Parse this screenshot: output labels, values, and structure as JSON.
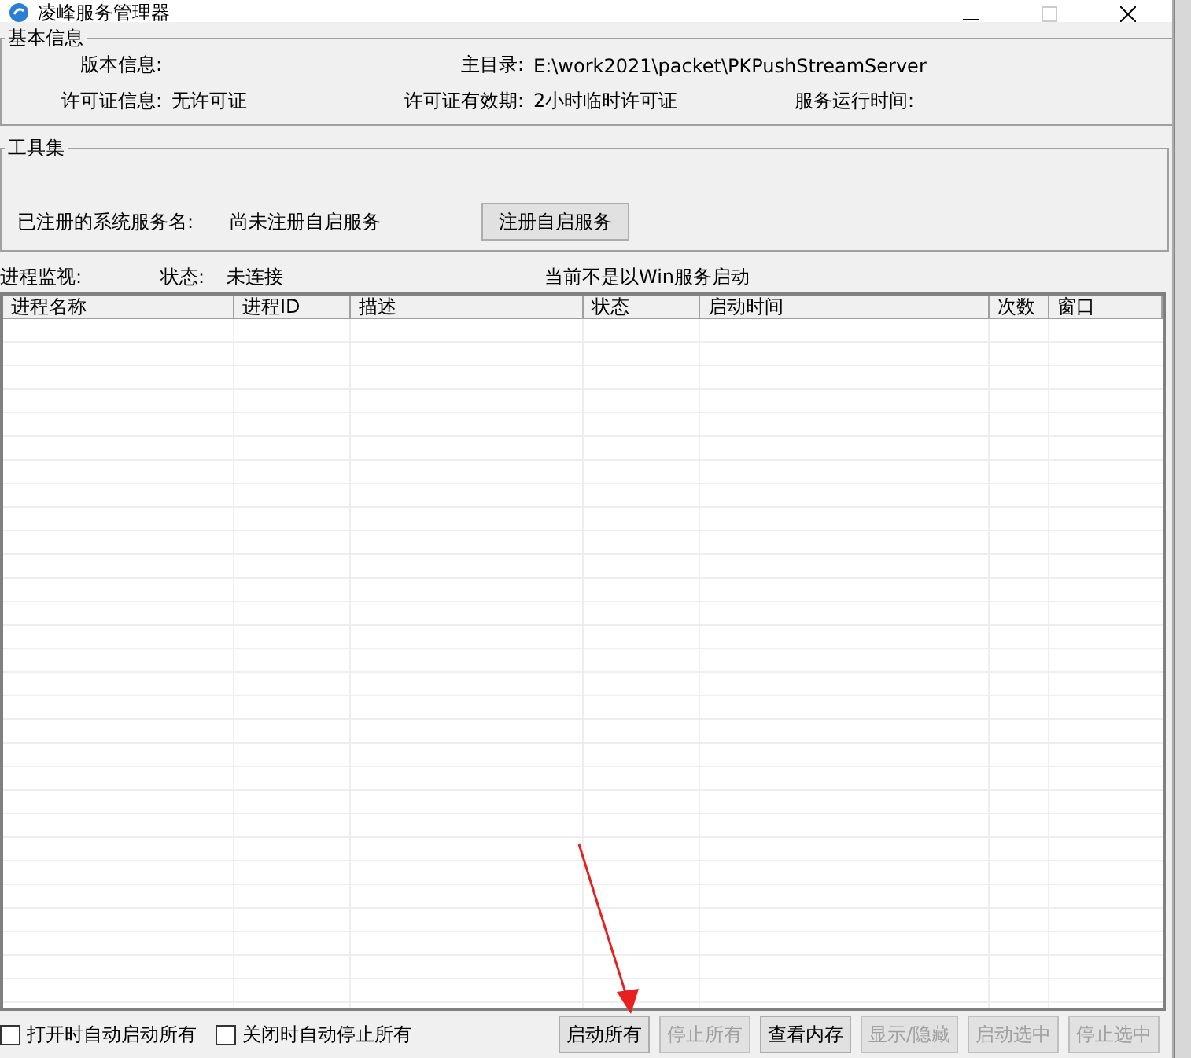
{
  "window": {
    "title": "凌峰服务管理器"
  },
  "basic_info": {
    "title": "基本信息",
    "fields": [
      {
        "label": "版本信息:"
      },
      {
        "label": "主目录:",
        "value": "E:\\work2021\\packet\\PKPushStreamServer"
      },
      {
        "label": "许可证信息:",
        "value": "无许可证"
      },
      {
        "label": "许可证有效期:",
        "value": "2小时临时许可证"
      },
      {
        "label": "服务运行时间:"
      }
    ]
  },
  "toolset": {
    "title": "工具集",
    "service_label": "已注册的系统服务名:",
    "service_value": "尚未注册自启服务",
    "register_button": "注册自启服务"
  },
  "monitor": {
    "label": "进程监视:",
    "status_label": "状态:",
    "status_value": "未连接",
    "mode_text": "当前不是以Win服务启动"
  },
  "table": {
    "columns": [
      "进程名称",
      "进程ID",
      "描述",
      "状态",
      "启动时间",
      "次数",
      "窗口"
    ]
  },
  "options": [
    {
      "label": "打开时自动启动所有",
      "checked": false
    },
    {
      "label": "关闭时自动停止所有",
      "checked": false
    }
  ],
  "buttons": [
    {
      "label": "启动所有",
      "disabled": false
    },
    {
      "label": "停止所有",
      "disabled": true
    },
    {
      "label": "查看内存",
      "disabled": false
    },
    {
      "label": "显示/隐藏",
      "disabled": true
    },
    {
      "label": "启动选中",
      "disabled": true
    },
    {
      "label": "停止选中",
      "disabled": true
    }
  ]
}
